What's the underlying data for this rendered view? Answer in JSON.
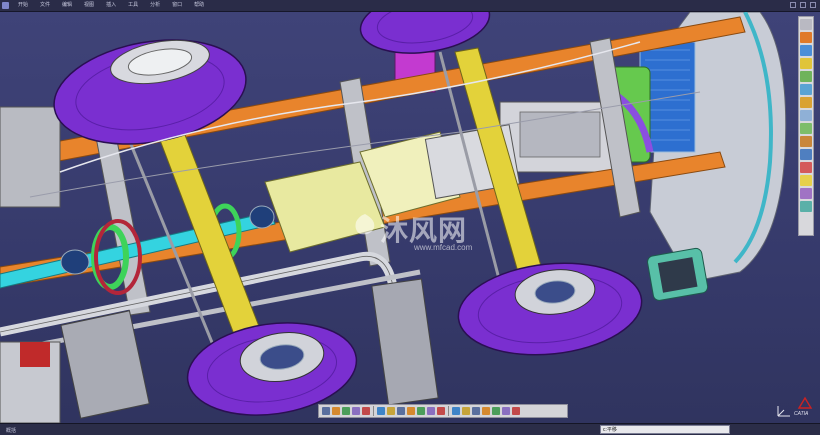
{
  "menubar": {
    "items": [
      {
        "label": "开始"
      },
      {
        "label": "文件"
      },
      {
        "label": "编辑"
      },
      {
        "label": "视图"
      },
      {
        "label": "插入"
      },
      {
        "label": "工具"
      },
      {
        "label": "分析"
      },
      {
        "label": "窗口"
      },
      {
        "label": "帮助"
      }
    ]
  },
  "viewport": {
    "watermark_text": "沐风网",
    "watermark_url": "www.mfcad.com",
    "logo_text": "CATIA"
  },
  "right_toolbar": {
    "icons": [
      "product-icon",
      "zoom-icon",
      "rotate-icon",
      "pan-icon",
      "fit-icon",
      "normal-view-icon",
      "view-mode-icon",
      "hide-show-icon",
      "swap-space-icon",
      "measure-icon",
      "section-icon",
      "clash-icon",
      "light-icon",
      "material-icon",
      "apply-icon"
    ],
    "colors": [
      "#b9b9c2",
      "#e07a2a",
      "#4b8ed8",
      "#e0c43a",
      "#6fb35b",
      "#5aa3d3",
      "#d9a233",
      "#8fb0d6",
      "#7dbd6a",
      "#c9863a",
      "#4f7fc0",
      "#d45a5a",
      "#e6d04b",
      "#a073c4",
      "#5ab0a8"
    ]
  },
  "bottom_toolbar": {
    "icons": [
      "select-icon",
      "snap-icon",
      "sketch-icon",
      "constraint-icon",
      "product-icon",
      "grid-icon",
      "fly-icon",
      "fit-all-icon",
      "pan-icon",
      "rotate-icon",
      "zoom-in-icon",
      "zoom-out-icon",
      "normal-icon",
      "views-icon",
      "render-icon",
      "hide-icon",
      "swap-icon",
      "measure-icon",
      "spec-icon"
    ]
  },
  "statusbar": {
    "status_text": "概括",
    "command_value": "c:平移"
  },
  "colors": {
    "background": "#3b3f72",
    "frame_orange": "#e8842c",
    "tire_purple": "#7a2fd0",
    "axle_yellow": "#e3d23a",
    "shaft_cyan": "#34d3e0",
    "engine_yellow": "#e8e9a0",
    "grey_part": "#c9cad0"
  }
}
